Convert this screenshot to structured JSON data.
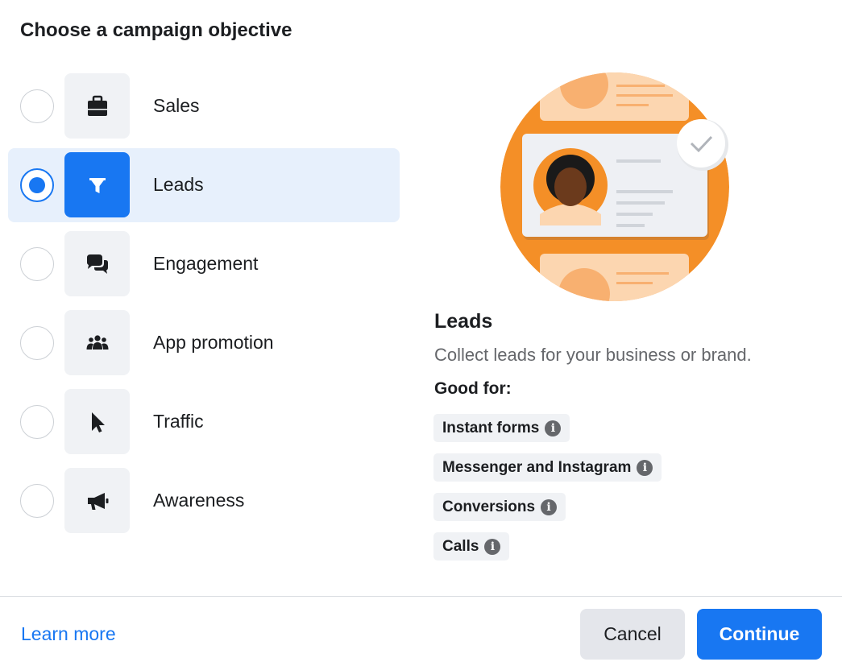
{
  "dialog": {
    "title": "Choose a campaign objective"
  },
  "objectives": [
    {
      "label": "Sales",
      "icon": "briefcase-icon",
      "selected": false
    },
    {
      "label": "Leads",
      "icon": "filter-icon",
      "selected": true
    },
    {
      "label": "Engagement",
      "icon": "chat-bubbles-icon",
      "selected": false
    },
    {
      "label": "App promotion",
      "icon": "people-group-icon",
      "selected": false
    },
    {
      "label": "Traffic",
      "icon": "cursor-icon",
      "selected": false
    },
    {
      "label": "Awareness",
      "icon": "megaphone-icon",
      "selected": false
    }
  ],
  "detail": {
    "title": "Leads",
    "description": "Collect leads for your business or brand.",
    "good_for_label": "Good for:",
    "chips": [
      "Instant forms",
      "Messenger and Instagram",
      "Conversions",
      "Calls"
    ]
  },
  "footer": {
    "learn_more": "Learn more",
    "cancel": "Cancel",
    "continue": "Continue"
  },
  "colors": {
    "accent": "#1877f2",
    "selected_bg": "#e7f0fc",
    "illustration_orange": "#f48f27"
  }
}
